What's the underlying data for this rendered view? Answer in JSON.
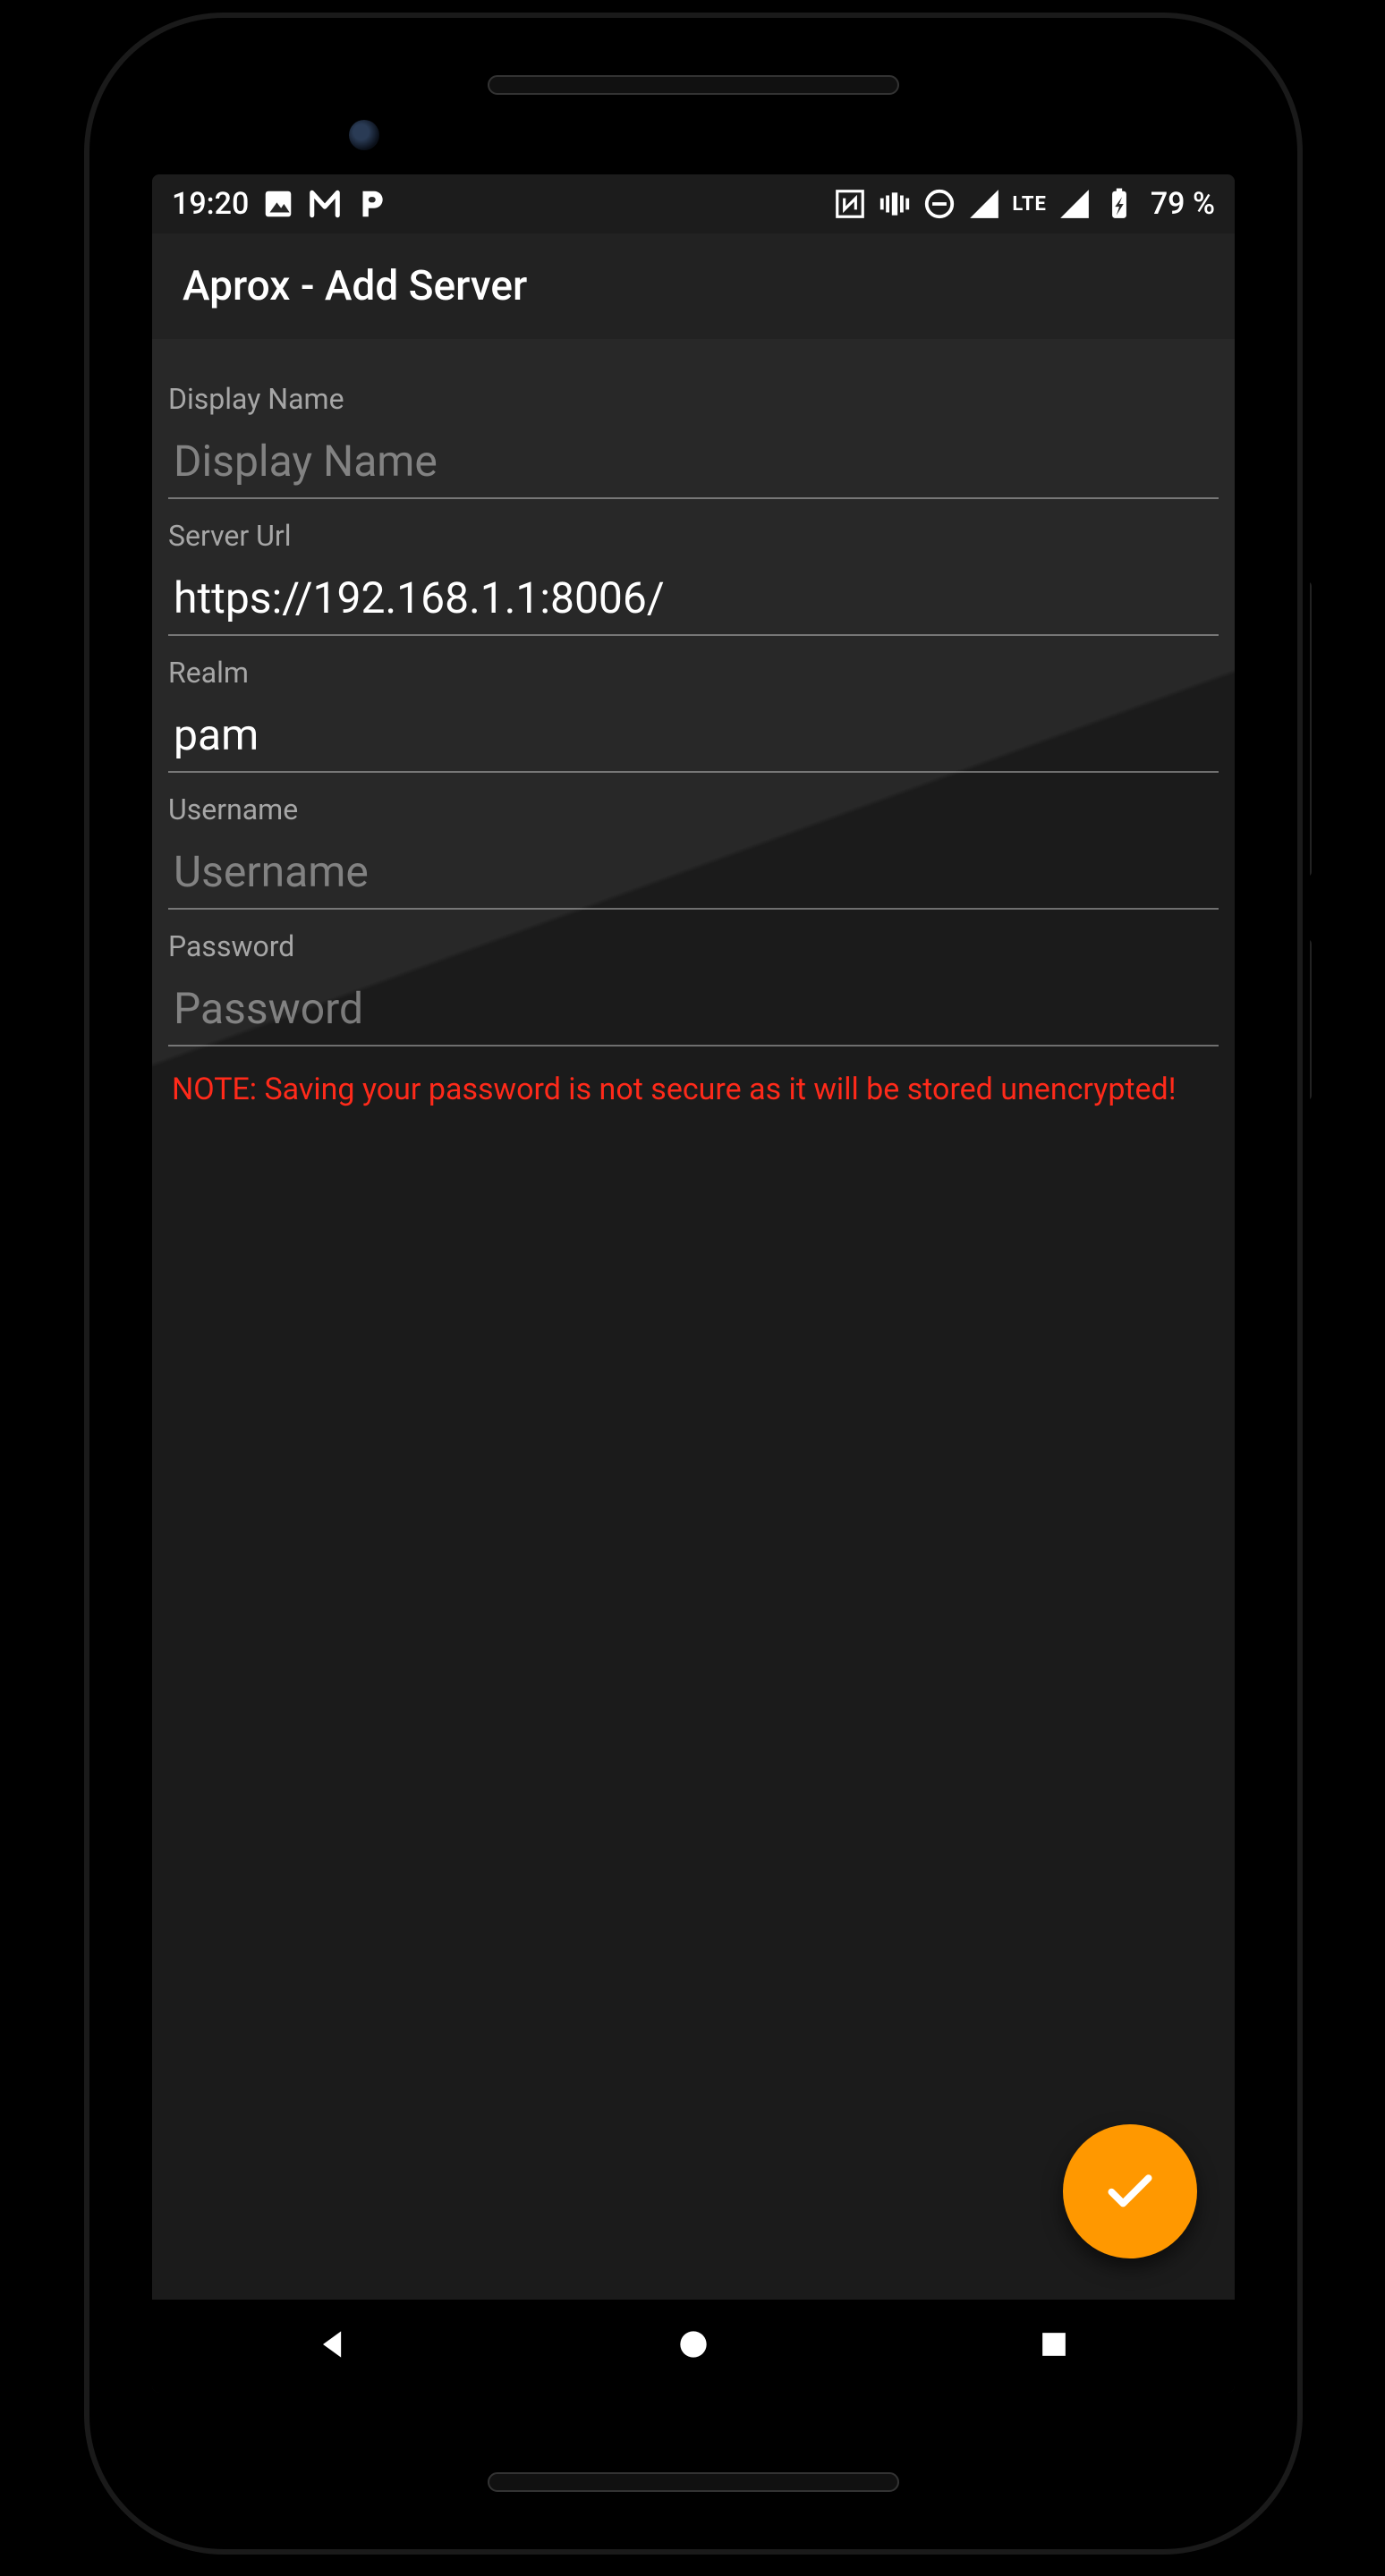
{
  "statusbar": {
    "time": "19:20",
    "network_label": "LTE",
    "battery_text": "79 %"
  },
  "appbar": {
    "title": "Aprox - Add Server"
  },
  "form": {
    "display_name": {
      "label": "Display Name",
      "placeholder": "Display Name",
      "value": ""
    },
    "server_url": {
      "label": "Server Url",
      "placeholder": "",
      "value": "https://192.168.1.1:8006/"
    },
    "realm": {
      "label": "Realm",
      "placeholder": "",
      "value": "pam"
    },
    "username": {
      "label": "Username",
      "placeholder": "Username",
      "value": ""
    },
    "password": {
      "label": "Password",
      "placeholder": "Password",
      "value": ""
    }
  },
  "note": "NOTE: Saving your password is not secure as it will be stored unencrypted!"
}
